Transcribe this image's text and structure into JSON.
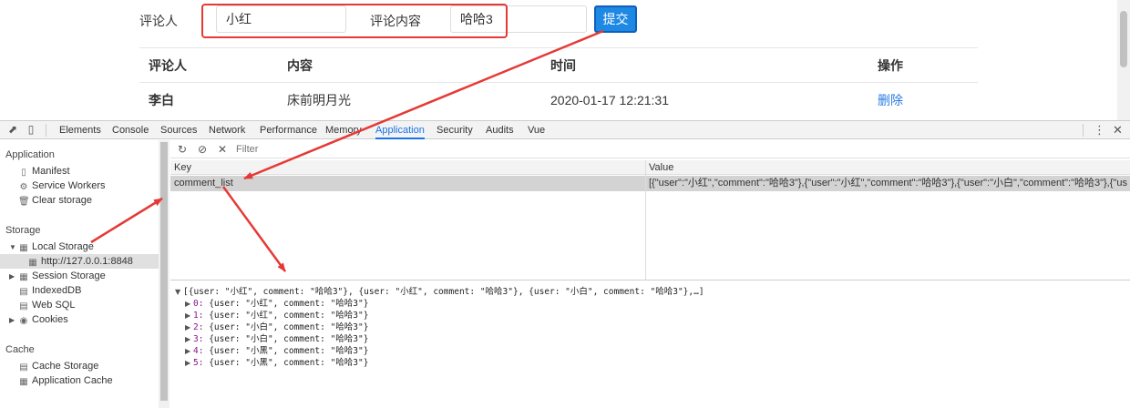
{
  "page": {
    "form": {
      "user_label": "评论人",
      "user_value": "小红",
      "comment_label": "评论内容",
      "comment_value": "哈哈3",
      "submit_label": "提交"
    },
    "table": {
      "headers": [
        "评论人",
        "内容",
        "时间",
        "操作"
      ],
      "rows": [
        {
          "user": "李白",
          "content": "床前明月光",
          "time": "2020-01-17 12:21:31",
          "action": "删除"
        }
      ]
    }
  },
  "devtools": {
    "tabs": [
      "Elements",
      "Console",
      "Sources",
      "Network",
      "Performance",
      "Memory",
      "Application",
      "Security",
      "Audits",
      "Vue"
    ],
    "active_tab": "Application",
    "sidebar": {
      "application_title": "Application",
      "application_items": [
        "Manifest",
        "Service Workers",
        "Clear storage"
      ],
      "storage_title": "Storage",
      "local_storage": "Local Storage",
      "local_storage_origin": "http://127.0.0.1:8848",
      "session_storage": "Session Storage",
      "indexeddb": "IndexedDB",
      "websql": "Web SQL",
      "cookies": "Cookies",
      "cache_title": "Cache",
      "cache_storage": "Cache Storage",
      "app_cache": "Application Cache"
    },
    "filter_placeholder": "Filter",
    "grid": {
      "key_header": "Key",
      "value_header": "Value",
      "key": "comment_list",
      "value": "[{\"user\":\"小红\",\"comment\":\"哈哈3\"},{\"user\":\"小红\",\"comment\":\"哈哈3\"},{\"user\":\"小白\",\"comment\":\"哈哈3\"},{\"user\":\"小白\",..."
    },
    "preview": {
      "summary": "[{user: \"小红\", comment: \"哈哈3\"}, {user: \"小红\", comment: \"哈哈3\"}, {user: \"小白\", comment: \"哈哈3\"},…]",
      "items": [
        {
          "index": "0:",
          "text": "{user: \"小红\", comment: \"哈哈3\"}"
        },
        {
          "index": "1:",
          "text": "{user: \"小红\", comment: \"哈哈3\"}"
        },
        {
          "index": "2:",
          "text": "{user: \"小白\", comment: \"哈哈3\"}"
        },
        {
          "index": "3:",
          "text": "{user: \"小白\", comment: \"哈哈3\"}"
        },
        {
          "index": "4:",
          "text": "{user: \"小黑\", comment: \"哈哈3\"}"
        },
        {
          "index": "5:",
          "text": "{user: \"小黑\", comment: \"哈哈3\"}"
        }
      ]
    }
  },
  "colors": {
    "accent_blue": "#1e88e5",
    "annotation_red": "#e53935",
    "link_blue": "#2a7ae2"
  }
}
